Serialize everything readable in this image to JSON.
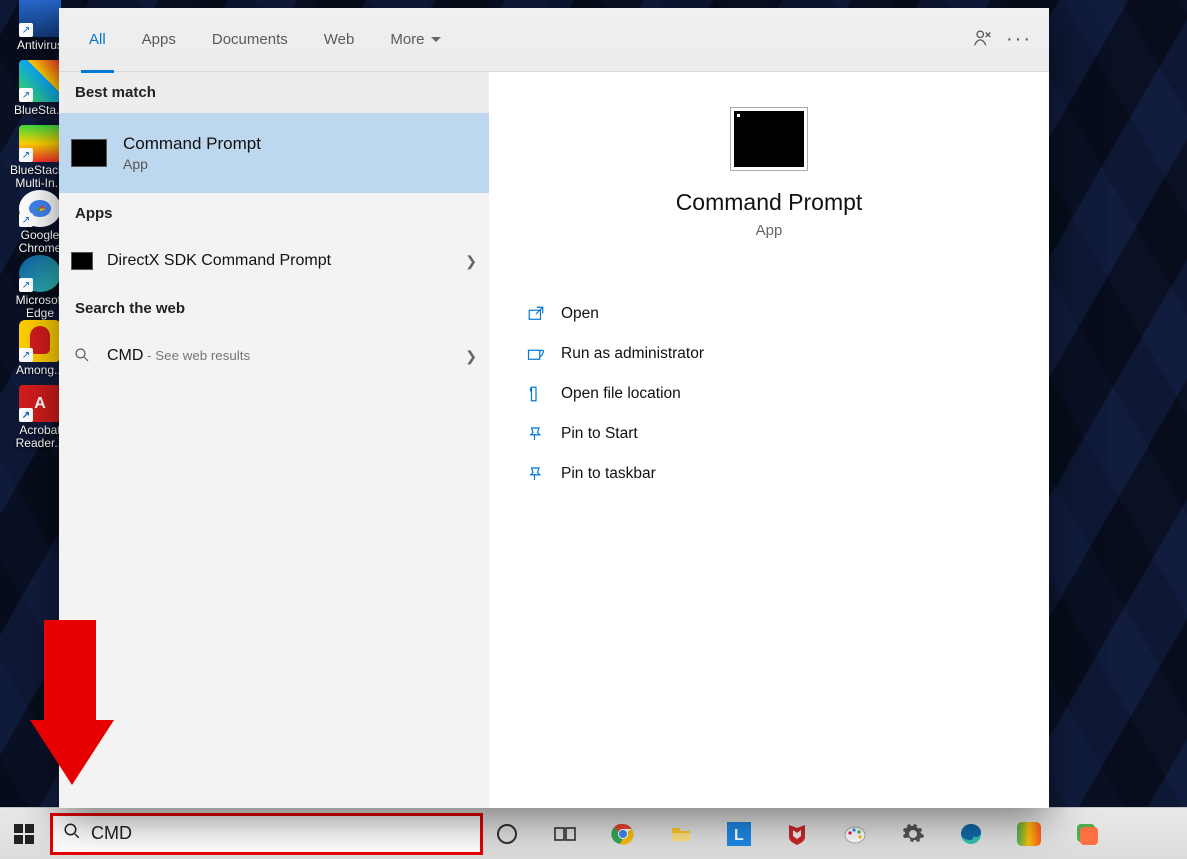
{
  "desktop_icons": [
    {
      "label": "Antivirus"
    },
    {
      "label": "BlueSta..."
    },
    {
      "label": "BlueStacks\nMulti-In..."
    },
    {
      "label": "Google\nChrome"
    },
    {
      "label": "Microsoft\nEdge"
    },
    {
      "label": "Among..."
    },
    {
      "label": "Acrobat\nReader..."
    }
  ],
  "tabs": {
    "all": "All",
    "apps": "Apps",
    "documents": "Documents",
    "web": "Web",
    "more": "More"
  },
  "left": {
    "best_match_heading": "Best match",
    "best_match": {
      "title": "Command Prompt",
      "subtitle": "App"
    },
    "apps_heading": "Apps",
    "app_result_title": "DirectX SDK Command Prompt",
    "web_heading": "Search the web",
    "web_q": "CMD",
    "web_suffix": " - See web results"
  },
  "preview": {
    "title": "Command Prompt",
    "subtitle": "App",
    "actions": [
      "Open",
      "Run as administrator",
      "Open file location",
      "Pin to Start",
      "Pin to taskbar"
    ]
  },
  "search_value": "CMD"
}
